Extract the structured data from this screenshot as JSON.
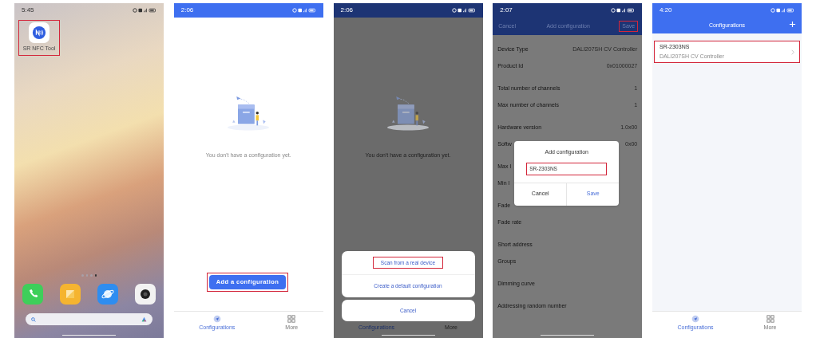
{
  "screens": [
    {
      "kind": "home",
      "status_time": "5:45",
      "app": {
        "label": "SR NFC Tool",
        "highlighted": true
      },
      "page_dots": [
        {
          "selected": false
        },
        {
          "selected": false
        },
        {
          "selected": false
        },
        {
          "selected": true
        }
      ]
    },
    {
      "kind": "empty",
      "status_time": "2:06",
      "message": "You don't have a configuration yet.",
      "add_button": {
        "label": "Add a configuration",
        "highlighted": true
      },
      "tabs": [
        {
          "label": "Configurations",
          "selected": true
        },
        {
          "label": "More",
          "selected": false
        }
      ]
    },
    {
      "kind": "sheet",
      "status_time": "2:06",
      "message": "You don't have a configuration yet.",
      "sheet_options": [
        {
          "label": "Scan from a real device",
          "highlighted": true
        },
        {
          "label": "Create a default configuration",
          "highlighted": false
        }
      ],
      "cancel": "Cancel",
      "tabs": [
        {
          "label": "Configurations",
          "selected": true
        },
        {
          "label": "More",
          "selected": false
        }
      ]
    },
    {
      "kind": "form",
      "status_time": "2:07",
      "nav": {
        "cancel": "Cancel",
        "title": "Add configuration",
        "save": {
          "label": "Save",
          "highlighted": true
        }
      },
      "row_groups": [
        [
          {
            "label": "Device Type",
            "value": "DALI207SH CV Controller"
          },
          {
            "label": "Product Id",
            "value": "0x01000027"
          }
        ],
        [
          {
            "label": "Total number of channels",
            "value": "1"
          },
          {
            "label": "Max number of channels",
            "value": "1"
          }
        ],
        [
          {
            "label": "Hardware version",
            "value": "1.0x00"
          },
          {
            "label": "Softw",
            "value": "0x00"
          }
        ],
        [
          {
            "label": "Max l"
          },
          {
            "label": "Min l"
          }
        ],
        [
          {
            "label": "Fade"
          },
          {
            "label": "Fade rate"
          }
        ],
        [
          {
            "label": "Short address"
          },
          {
            "label": "Groups"
          }
        ],
        [
          {
            "label": "Dimming curve"
          }
        ],
        [
          {
            "label": "Addressing random number"
          }
        ]
      ],
      "dialog": {
        "title": "Add configuration",
        "input": {
          "value": "SR-2303NS",
          "highlighted": true
        },
        "buttons": [
          {
            "label": "Cancel",
            "kind": "plain"
          },
          {
            "label": "Save",
            "kind": "primary"
          }
        ]
      }
    },
    {
      "kind": "list",
      "status_time": "4:20",
      "title": "Configurations",
      "items": [
        {
          "name": "SR-2303NS",
          "detail": "DALI207SH CV Controller",
          "highlighted": true
        }
      ],
      "tabs": [
        {
          "label": "Configurations",
          "selected": true
        },
        {
          "label": "More",
          "selected": false
        }
      ]
    }
  ]
}
